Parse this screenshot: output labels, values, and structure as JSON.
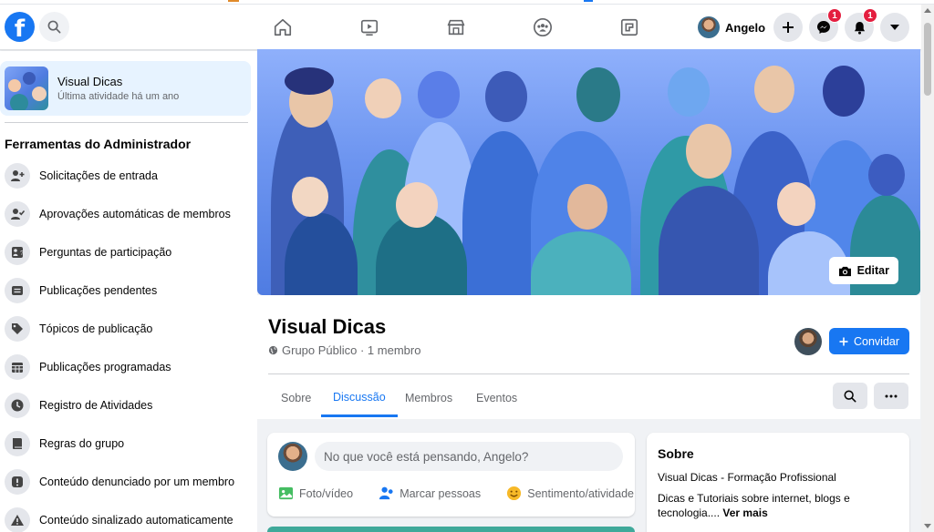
{
  "colors": {
    "brand": "#1877f2",
    "badge": "#e41e3f",
    "active_tab": "#1877f2"
  },
  "topnav": {
    "logo_letter": "f",
    "profile_name": "Angelo",
    "messenger_badge": "1",
    "notifications_badge": "1",
    "icons": [
      "search-icon",
      "home-icon",
      "watch-icon",
      "marketplace-icon",
      "groups-icon",
      "gaming-icon",
      "plus-icon",
      "messenger-icon",
      "bell-icon",
      "caret-down-icon"
    ]
  },
  "sidebar": {
    "group_name": "Visual Dicas",
    "group_activity": "Última atividade há um ano",
    "admin_title": "Ferramentas do Administrador",
    "items": [
      {
        "label": "Solicitações de entrada",
        "icon": "user-add-icon"
      },
      {
        "label": "Aprovações automáticas de membros",
        "icon": "user-check-icon"
      },
      {
        "label": "Perguntas de participação",
        "icon": "question-icon"
      },
      {
        "label": "Publicações pendentes",
        "icon": "posts-icon"
      },
      {
        "label": "Tópicos de publicação",
        "icon": "tag-icon"
      },
      {
        "label": "Publicações programadas",
        "icon": "calendar-icon"
      },
      {
        "label": "Registro de Atividades",
        "icon": "clock-icon"
      },
      {
        "label": "Regras do grupo",
        "icon": "book-icon"
      },
      {
        "label": "Conteúdo denunciado por um membro",
        "icon": "alert-icon"
      },
      {
        "label": "Conteúdo sinalizado automaticamente",
        "icon": "warning-icon"
      }
    ]
  },
  "cover": {
    "edit_label": "Editar"
  },
  "group": {
    "title": "Visual Dicas",
    "privacy": "Grupo Público · 1 membro",
    "invite_label": "Convidar",
    "tabs": [
      "Sobre",
      "Discussão",
      "Membros",
      "Eventos"
    ],
    "active_tab": "Discussão"
  },
  "composer": {
    "placeholder": "No que você está pensando, Angelo?",
    "actions": [
      "Foto/vídeo",
      "Marcar pessoas",
      "Sentimento/atividade"
    ]
  },
  "about": {
    "title": "Sobre",
    "line1": "Visual Dicas - Formação Profissional",
    "line2": "Dicas e Tutoriais sobre internet, blogs e tecnologia....",
    "see_more": "Ver mais"
  }
}
